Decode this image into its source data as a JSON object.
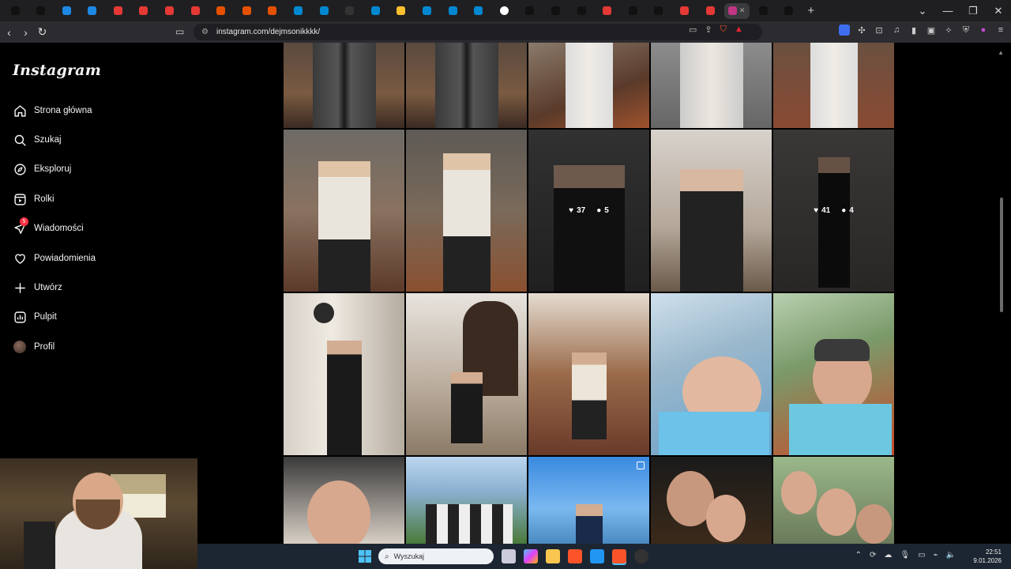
{
  "browser": {
    "url": "instagram.com/dejmsonikkkk/",
    "tabs": [
      {
        "icon": "tiktok-icon",
        "color": "#111"
      },
      {
        "icon": "tiktok-icon",
        "color": "#111"
      },
      {
        "icon": "site-icon",
        "color": "#1e88e5"
      },
      {
        "icon": "site-icon",
        "color": "#1e88e5"
      },
      {
        "icon": "youtube-icon",
        "color": "#e53935"
      },
      {
        "icon": "youtube-icon",
        "color": "#e53935"
      },
      {
        "icon": "youtube-icon",
        "color": "#e53935"
      },
      {
        "icon": "youtube-icon",
        "color": "#e53935"
      },
      {
        "icon": "site-icon",
        "color": "#e65100"
      },
      {
        "icon": "site-icon",
        "color": "#e65100"
      },
      {
        "icon": "site-icon",
        "color": "#e65100"
      },
      {
        "icon": "site-icon",
        "color": "#0288d1"
      },
      {
        "icon": "site-icon",
        "color": "#0288d1"
      },
      {
        "icon": "x-icon",
        "color": "#333"
      },
      {
        "icon": "site-icon",
        "color": "#0288d1"
      },
      {
        "icon": "site-icon",
        "color": "#fbc02d"
      },
      {
        "icon": "site-icon",
        "color": "#0288d1"
      },
      {
        "icon": "site-icon",
        "color": "#0288d1"
      },
      {
        "icon": "site-icon",
        "color": "#0288d1"
      },
      {
        "icon": "google-icon",
        "color": "#fff"
      },
      {
        "icon": "tiktok-icon",
        "color": "#111"
      },
      {
        "icon": "tiktok-icon",
        "color": "#111"
      },
      {
        "icon": "tiktok-icon",
        "color": "#111"
      },
      {
        "icon": "youtube-icon",
        "color": "#e53935"
      },
      {
        "icon": "tiktok-icon",
        "color": "#111"
      },
      {
        "icon": "tiktok-icon",
        "color": "#111"
      },
      {
        "icon": "youtube-icon",
        "color": "#e53935"
      },
      {
        "icon": "youtube-icon",
        "color": "#e53935"
      },
      {
        "icon": "instagram-icon",
        "color": "#c13584",
        "active": true
      },
      {
        "icon": "tiktok-icon",
        "color": "#111"
      },
      {
        "icon": "tiktok-icon",
        "color": "#111"
      }
    ]
  },
  "sidebar": {
    "logo": "Instagram",
    "items": [
      {
        "label": "Strona główna",
        "icon": "home-icon"
      },
      {
        "label": "Szukaj",
        "icon": "search-icon"
      },
      {
        "label": "Eksploruj",
        "icon": "compass-icon"
      },
      {
        "label": "Rolki",
        "icon": "reels-icon"
      },
      {
        "label": "Wiadomości",
        "icon": "messenger-icon",
        "badge": "5"
      },
      {
        "label": "Powiadomienia",
        "icon": "heart-icon"
      },
      {
        "label": "Utwórz",
        "icon": "plus-icon"
      },
      {
        "label": "Pulpit",
        "icon": "dashboard-icon"
      },
      {
        "label": "Profil",
        "icon": "avatar"
      }
    ]
  },
  "posts": {
    "hover1": {
      "likes": "37",
      "comments": "5"
    },
    "hover2": {
      "likes": "41",
      "comments": "4"
    }
  },
  "taskbar": {
    "search_placeholder": "Wyszukaj",
    "time": "22:51",
    "date": "9.01.2026"
  }
}
